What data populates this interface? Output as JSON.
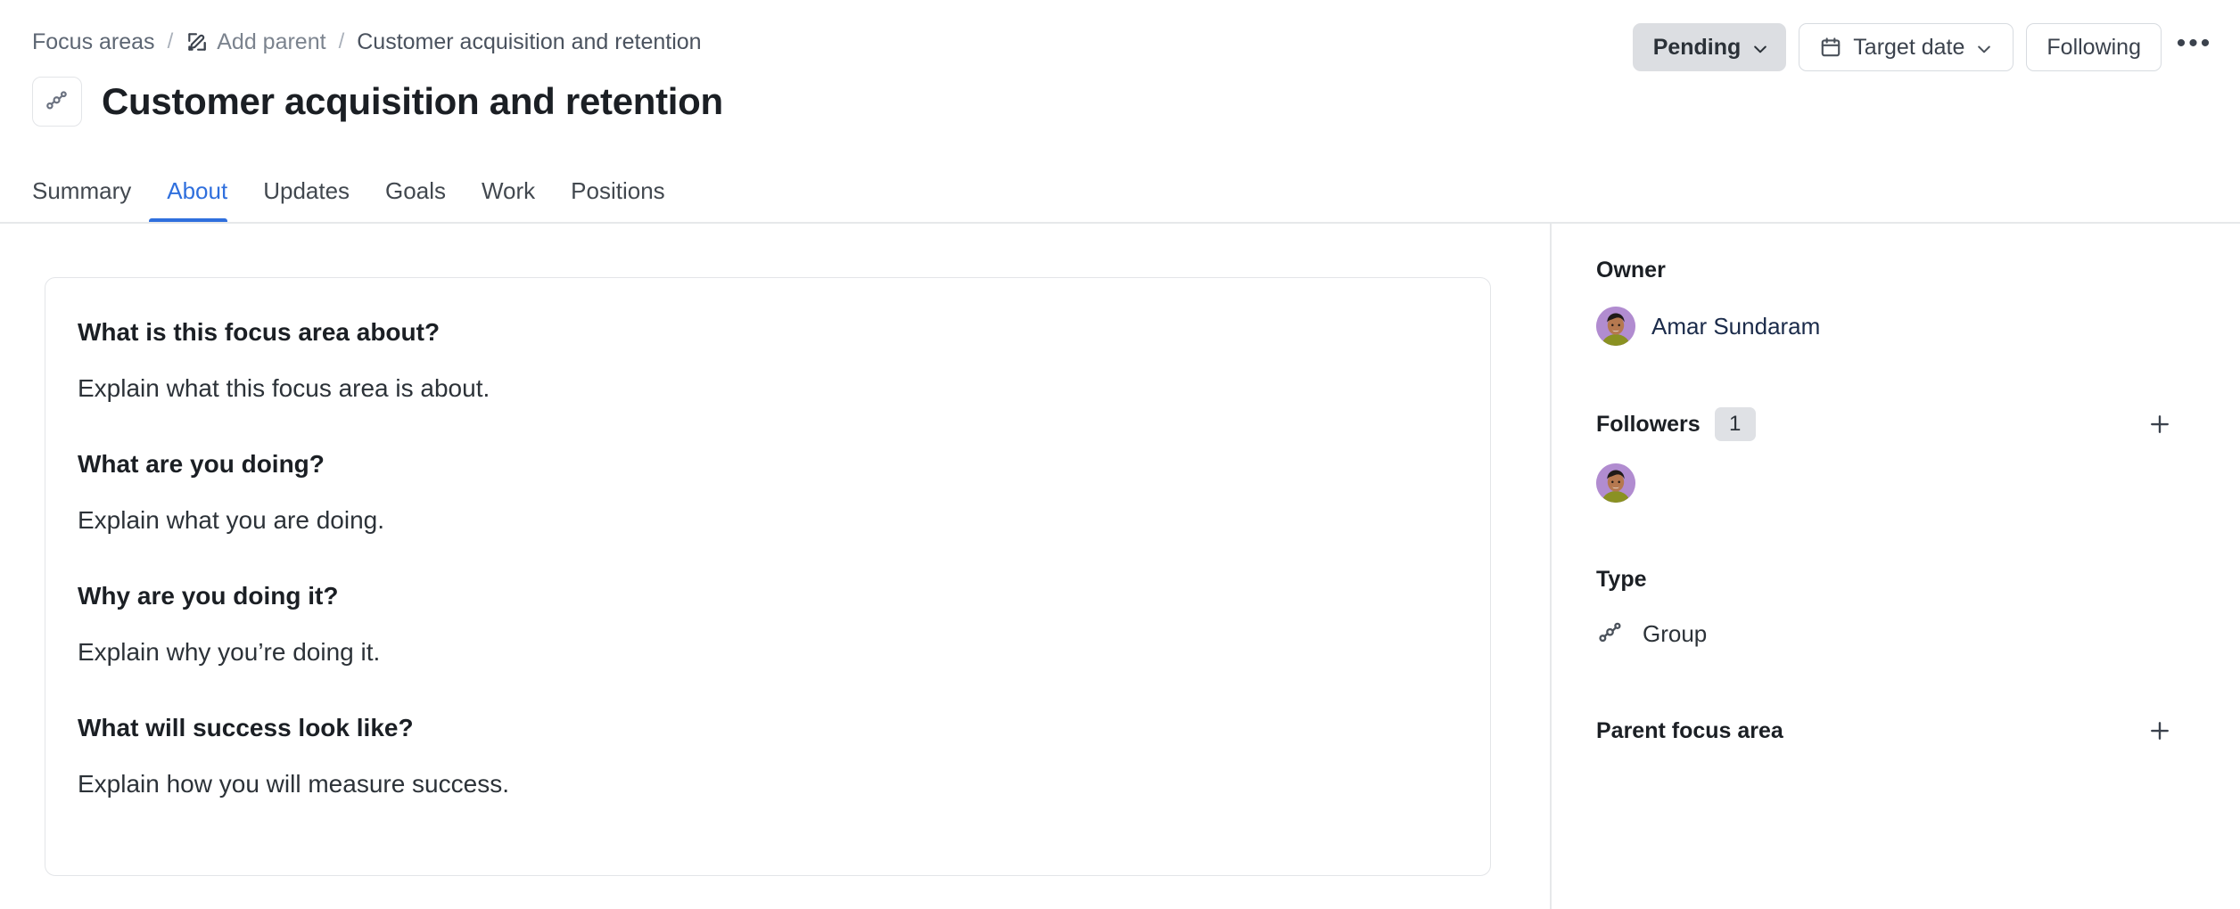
{
  "breadcrumb": {
    "root_label": "Focus areas",
    "separator": "/",
    "add_parent_label": "Add parent",
    "add_parent_icon": "pencil-square-icon",
    "current_label": "Customer acquisition and retention"
  },
  "header": {
    "title": "Customer acquisition and retention",
    "type_icon": "group-nodes-icon",
    "actions": {
      "status_label": "Pending",
      "status_chevron_icon": "chevron-down-icon",
      "target_date_label": "Target date",
      "target_date_icon": "calendar-icon",
      "target_date_chevron_icon": "chevron-down-icon",
      "following_label": "Following",
      "more_label": "•••",
      "more_icon": "ellipsis-horizontal-icon"
    },
    "accent_color": "#2f6fdd",
    "status_bg_color": "#dcdee2"
  },
  "tabs": [
    {
      "label": "Summary",
      "active": false
    },
    {
      "label": "About",
      "active": true
    },
    {
      "label": "Updates",
      "active": false
    },
    {
      "label": "Goals",
      "active": false
    },
    {
      "label": "Work",
      "active": false
    },
    {
      "label": "Positions",
      "active": false
    }
  ],
  "about_card": {
    "blocks": [
      {
        "heading": "What is this focus area about?",
        "answer": "Explain what this focus area is about."
      },
      {
        "heading": "What are you doing?",
        "answer": "Explain what you are doing."
      },
      {
        "heading": "Why are you doing it?",
        "answer": "Explain why you’re doing it."
      },
      {
        "heading": "What will success look like?",
        "answer": "Explain how you will measure success."
      }
    ]
  },
  "sidebar": {
    "owner": {
      "label": "Owner",
      "name": "Amar Sundaram",
      "avatar_icon": "user-avatar-photo",
      "avatar_bg_color": "#b18cd0"
    },
    "followers": {
      "label": "Followers",
      "count": "1",
      "add_icon": "plus-icon",
      "avatars": [
        {
          "avatar_icon": "user-avatar-photo",
          "avatar_bg_color": "#b18cd0"
        }
      ]
    },
    "type": {
      "label": "Type",
      "value": "Group",
      "icon": "group-nodes-icon"
    },
    "parent_focus_area": {
      "label": "Parent focus area",
      "add_icon": "plus-icon"
    }
  }
}
